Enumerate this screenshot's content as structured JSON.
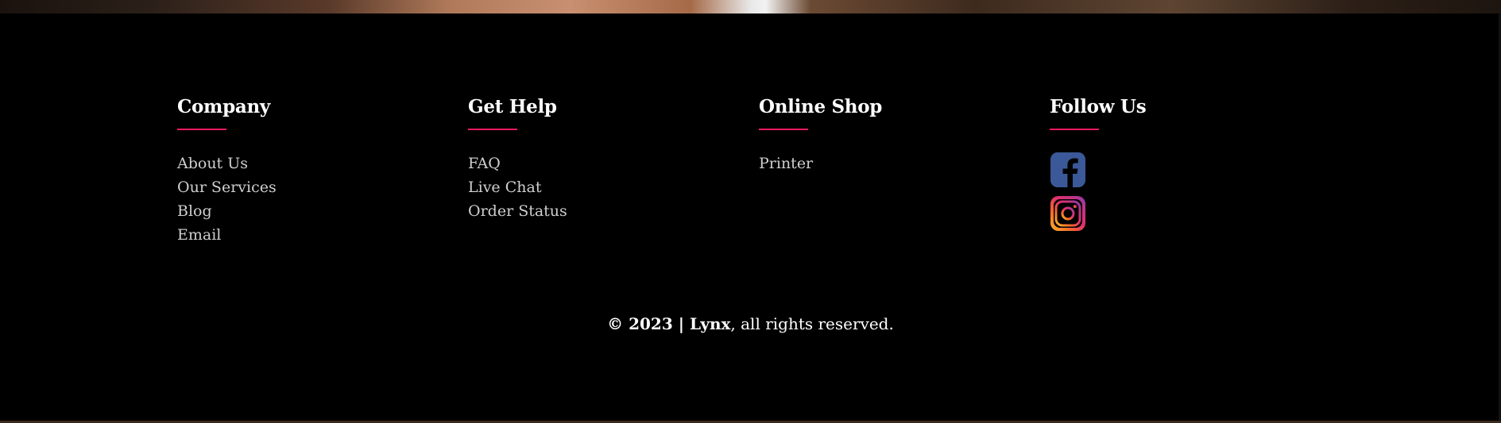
{
  "columns": [
    {
      "heading": "Company",
      "links": [
        "About Us",
        "Our Services",
        "Blog",
        "Email"
      ]
    },
    {
      "heading": "Get Help",
      "links": [
        "FAQ",
        "Live Chat",
        "Order Status"
      ]
    },
    {
      "heading": "Online Shop",
      "links": [
        "Printer"
      ]
    },
    {
      "heading": "Follow Us",
      "social": [
        "facebook-icon",
        "instagram-icon"
      ]
    }
  ],
  "copyright": {
    "prefix": "© 2023 | Lynx",
    "suffix": ", all rights reserved."
  },
  "colors": {
    "accent": "#e8195f",
    "background": "#000000",
    "facebook": "#3b5998"
  }
}
